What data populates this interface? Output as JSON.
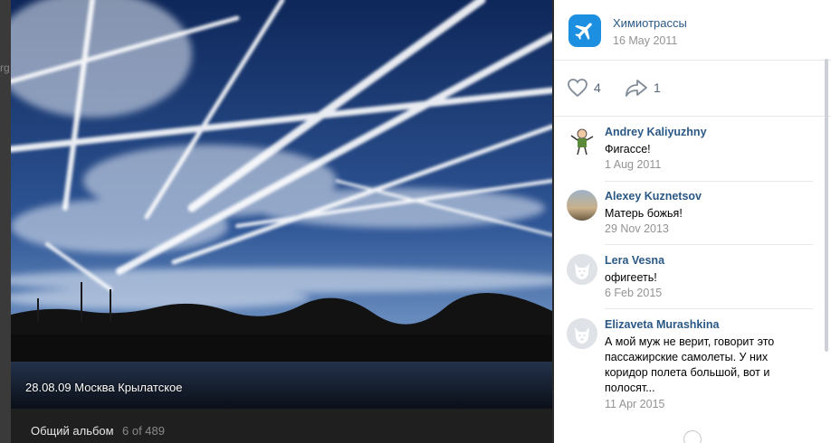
{
  "background": {
    "left_clip_text": "rg"
  },
  "photo": {
    "caption": "28.08.09 Москва Крылатское",
    "album_name": "Общий альбом",
    "album_position": "6 of 489"
  },
  "owner": {
    "name": "Химиотрассы",
    "date": "16 May 2011",
    "avatar_icon": "airplane-icon",
    "avatar_color": "#1d8fe1"
  },
  "actions": {
    "likes": "4",
    "shares": "1"
  },
  "comments": [
    {
      "author": "Andrey Kaliyuzhny",
      "text": "Фигассе!",
      "date": "1 Aug 2011",
      "avatar": "cartoon-avatar"
    },
    {
      "author": "Alexey Kuznetsov",
      "text": "Матерь божья!",
      "date": "29 Nov 2013",
      "avatar": "photo-avatar"
    },
    {
      "author": "Lera Vesna",
      "text": "офигееть!",
      "date": "6 Feb 2015",
      "avatar": "default-dog-avatar"
    },
    {
      "author": "Elizaveta Murashkina",
      "text": "А мой муж не верит, говорит это пассажирские самолеты. У них коридор полета большой, вот и полосят...",
      "date": "11 Apr 2015",
      "avatar": "default-dog-avatar"
    }
  ],
  "colors": {
    "link": "#2a5885",
    "muted": "#939393",
    "sky_top": "#0f2a5c",
    "sky_bottom": "#4f78b0"
  }
}
